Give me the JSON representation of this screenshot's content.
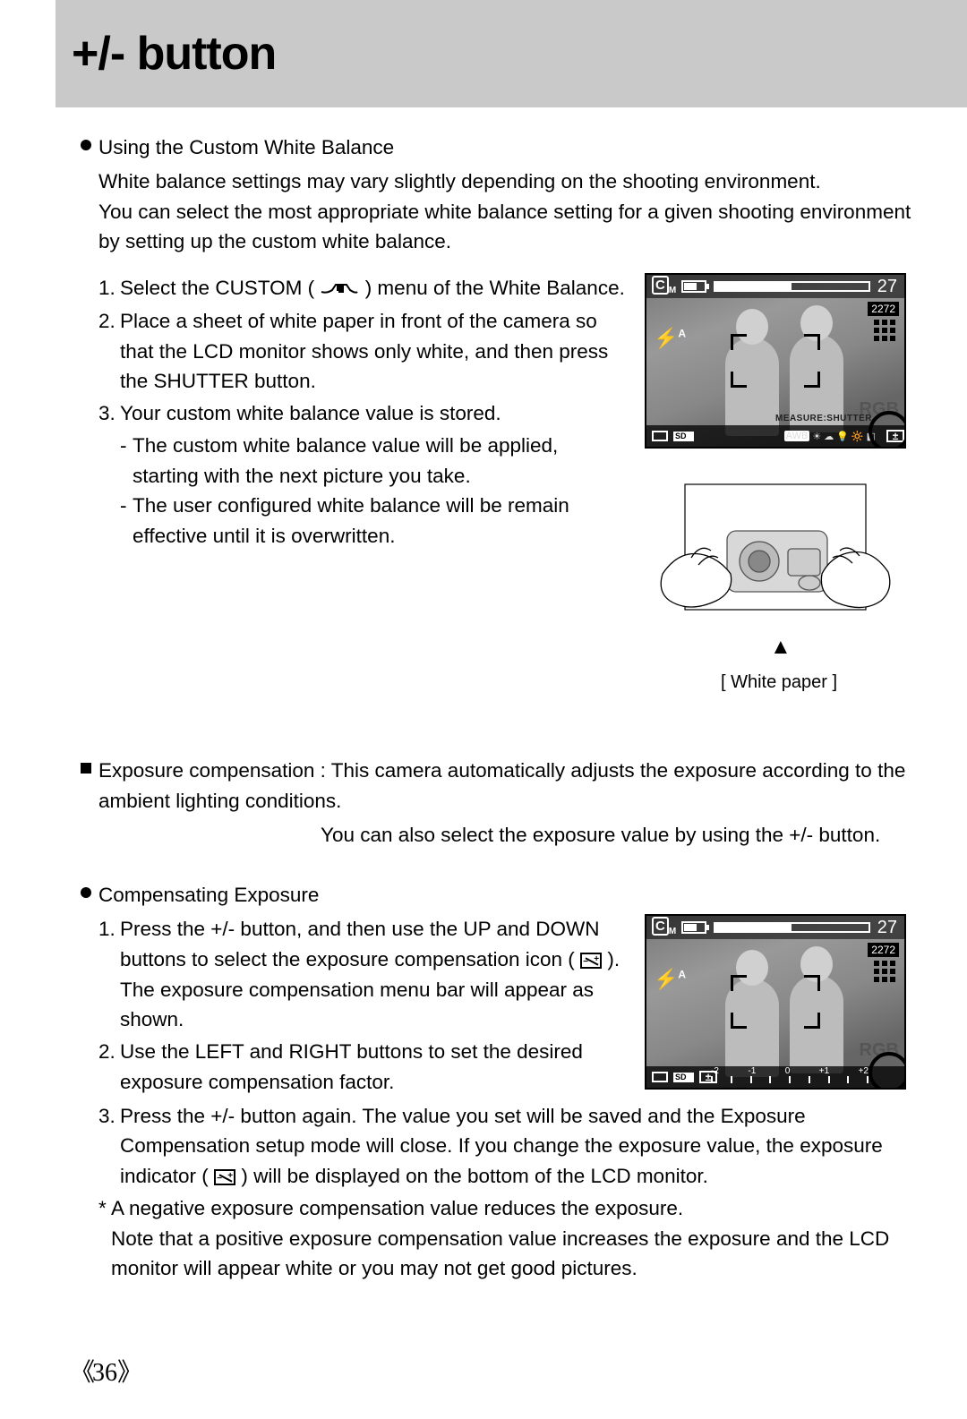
{
  "header": {
    "title": "+/- button"
  },
  "section1": {
    "bullet_title": "Using the Custom White Balance",
    "para1": "White balance settings may vary slightly depending on the shooting environment.",
    "para2": "You can select the most appropriate white balance setting for a given shooting environment by setting up the custom white balance.",
    "steps": {
      "s1_a": "Select the CUSTOM (",
      "s1_b": ") menu of the White Balance.",
      "s2": "Place a sheet of white paper in front of the camera so that the LCD monitor shows only white, and then press the SHUTTER button.",
      "s3": "Your custom white balance value is stored.",
      "s3_sub1": "The custom white balance value will be applied, starting with the next picture you take.",
      "s3_sub2": "The user configured white balance will be remain effective until it is overwritten."
    },
    "lcd": {
      "mode": "M",
      "count": "27",
      "res": "2272",
      "rgb": "RGB",
      "measure": "MEASURE:SHUTTER",
      "wb_sel": "AWB"
    },
    "caption": "[ White paper ]"
  },
  "section2": {
    "label": "Exposure compensation :",
    "line1": "This camera automatically adjusts the exposure according to the ambient lighting conditions.",
    "line2": "You can also select the exposure value by using the +/- button."
  },
  "section3": {
    "bullet_title": "Compensating Exposure",
    "s1_a": "Press the +/- button, and then use the UP and DOWN buttons to select the exposure compensation icon (",
    "s1_b": "). The exposure compensation menu bar will appear as shown.",
    "s2": "Use the LEFT and RIGHT buttons to set the desired exposure compensation factor.",
    "s3_a": "Press the +/- button again. The value you set will be saved and the Exposure Compensation setup mode will close. If you change the exposure value, the exposure indicator (",
    "s3_b": ") will be displayed on the bottom of the LCD monitor.",
    "note_a": "A negative exposure compensation value reduces the exposure.",
    "note_b": "Note that a positive exposure compensation value increases the exposure and the LCD monitor will appear white or you may not get good pictures.",
    "lcd": {
      "mode": "M",
      "count": "27",
      "res": "2272",
      "rgb": "RGB",
      "ev_labels": [
        "-2",
        "-1",
        "0",
        "+1",
        "+2"
      ]
    }
  },
  "page_number": "36"
}
